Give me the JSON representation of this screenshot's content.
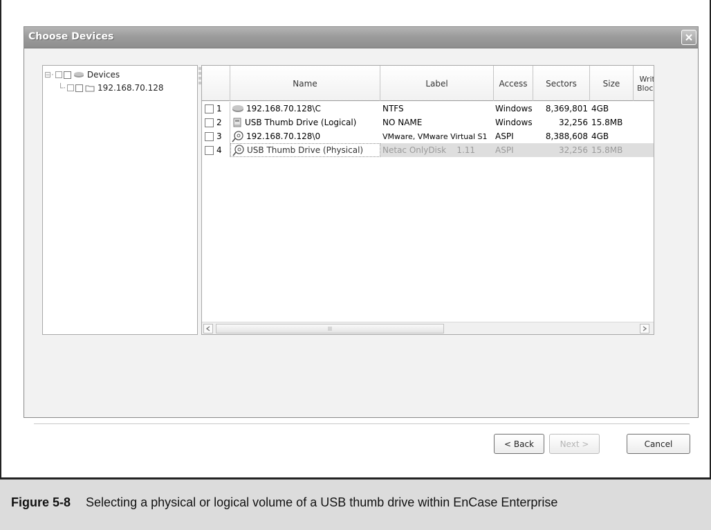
{
  "dialog": {
    "title": "Choose Devices"
  },
  "tree": {
    "items": [
      {
        "label": "Devices"
      },
      {
        "label": "192.168.70.128"
      }
    ]
  },
  "grid": {
    "columns": [
      "Name",
      "Label",
      "Access",
      "Sectors",
      "Size",
      "Write\nBlocke"
    ],
    "rows": [
      {
        "index": "1",
        "name": "192.168.70.128\\C",
        "label": "NTFS",
        "access": "Windows",
        "sectors": "8,369,801",
        "size": "4GB",
        "icon": "network-drive-icon"
      },
      {
        "index": "2",
        "name": "USB Thumb Drive (Logical)",
        "label": "NO NAME",
        "access": "Windows",
        "sectors": "32,256",
        "size": "15.8MB",
        "icon": "removable-drive-icon"
      },
      {
        "index": "3",
        "name": "192.168.70.128\\0",
        "label": "VMware, VMware Virtual S1",
        "access": "ASPI",
        "sectors": "8,388,608",
        "size": "4GB",
        "icon": "physical-disk-icon"
      },
      {
        "index": "4",
        "name": "USB Thumb Drive (Physical)",
        "label": "Netac OnlyDisk    1.11",
        "access": "ASPI",
        "sectors": "32,256",
        "size": "15.8MB",
        "icon": "physical-disk-icon",
        "selected": true
      }
    ]
  },
  "buttons": {
    "back": "< Back",
    "next": "Next >",
    "cancel": "Cancel"
  },
  "caption": {
    "number": "Figure 5-8",
    "text": "Selecting a physical or logical volume of a USB thumb drive within EnCase Enterprise"
  }
}
